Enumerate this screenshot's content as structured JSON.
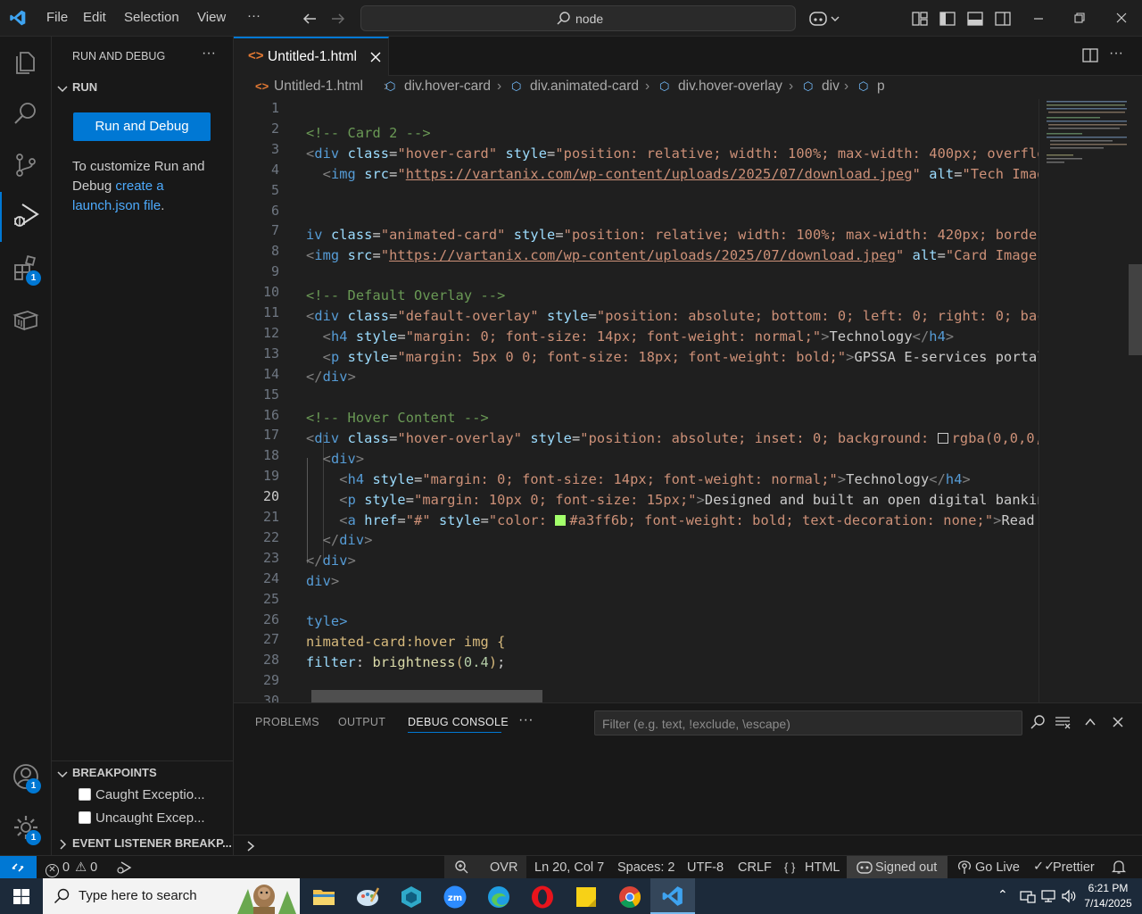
{
  "titlebar": {
    "menu": [
      "File",
      "Edit",
      "Selection",
      "View",
      "···"
    ],
    "command_center": "node"
  },
  "activitybar": {
    "icons": [
      "explorer-icon",
      "search-icon",
      "source-control-icon",
      "run-debug-icon",
      "extensions-icon",
      "remote-explorer-icon",
      "accounts-icon",
      "manage-icon"
    ],
    "extensions_badge": "1",
    "accounts_badge": "1",
    "manage_badge": "1"
  },
  "sidebar": {
    "title": "RUN AND DEBUG",
    "run_section": "RUN",
    "run_button": "Run and Debug",
    "customize_text_1": "To customize Run and Debug ",
    "customize_link_1": "create a launch.json file",
    "customize_text_2": ".",
    "breakpoints_header": "BREAKPOINTS",
    "breakpoints": [
      "Caught Exceptio...",
      "Uncaught Excep..."
    ],
    "event_listener_header": "EVENT LISTENER BREAKP..."
  },
  "editor": {
    "tab_name": "Untitled-1.html",
    "breadcrumb": [
      "Untitled-1.html",
      "div.hover-card",
      "div.animated-card",
      "div.hover-overlay",
      "div",
      "p"
    ],
    "current_line": 20,
    "line_numbers": [
      "1",
      "2",
      "3",
      "4",
      "5",
      "6",
      "7",
      "8",
      "9",
      "10",
      "11",
      "12",
      "13",
      "14",
      "15",
      "16",
      "17",
      "18",
      "19",
      "20",
      "21",
      "22",
      "23",
      "24",
      "25",
      "26",
      "27",
      "28",
      "29",
      "30"
    ],
    "lines": {
      "l2": "<!-- Card 2 -->",
      "l3_class": "\"hover-card\"",
      "l3_style": "\"position: relative; width: 100%; max-width: 400px; overflo",
      "l4_url": "https://vartanix.com/wp-content/uploads/2025/07/download.jpeg",
      "l4_alt": "\"Tech Imag",
      "l7_pre": "iv ",
      "l7_class": "\"animated-card\"",
      "l7_style": "\"position: relative; width: 100%; max-width: 420px; border",
      "l8_url": "https://vartanix.com/wp-content/uploads/2025/07/download.jpeg",
      "l8_alt": "\"Card Image\"",
      "l10": "<!-- Default Overlay -->",
      "l11_class": "\"default-overlay\"",
      "l11_style": "\"position: absolute; bottom: 0; left: 0; right: 0; bac",
      "l12_style": "\"margin: 0; font-size: 14px; font-weight: normal;\"",
      "l12_text": "Technology",
      "l13_style": "\"margin: 5px 0 0; font-size: 18px; font-weight: bold;\"",
      "l13_text": "GPSSA E-services portal",
      "l16": "<!-- Hover Content -->",
      "l17_class": "\"hover-overlay\"",
      "l17_style_a": "\"position: absolute; inset: 0; background: ",
      "l17_style_b": "rgba(0,0,0,",
      "l19_style": "\"margin: 0; font-size: 14px; font-weight: normal;\"",
      "l19_text": "Technology",
      "l20_style": "\"margin: 10px 0; font-size: 15px;\"",
      "l20_text": "Designed and built an open digital bankin",
      "l21_href": "\"#\"",
      "l21_style_a": "\"color: ",
      "l21_style_b": "#a3ff6b; font-weight: bold; text-decoration: none;\"",
      "l21_text": "Read",
      "l26": "tyle>",
      "l27": "nimated-card:hover img {",
      "l28_prop": "filter",
      "l28_fn": "brightness",
      "l28_num": "0.4"
    }
  },
  "panel": {
    "tabs": [
      "PROBLEMS",
      "OUTPUT",
      "DEBUG CONSOLE",
      "···"
    ],
    "filter_placeholder": "Filter (e.g. text, !exclude, \\escape)"
  },
  "statusbar": {
    "errors": "0",
    "warnings": "0",
    "overtype": "OVR",
    "position": "Ln 20, Col 7",
    "spaces": "Spaces: 2",
    "encoding": "UTF-8",
    "eol": "CRLF",
    "language": "HTML",
    "account": "Signed out",
    "golive": "Go Live",
    "prettier": "Prettier"
  },
  "taskbar": {
    "search_placeholder": "Type here to search",
    "time": "6:21 PM",
    "date": "7/14/2025"
  },
  "colors": {
    "accent": "#0078d4",
    "swatch_1": "#ffffff",
    "swatch_2": "#a3ff6b"
  }
}
